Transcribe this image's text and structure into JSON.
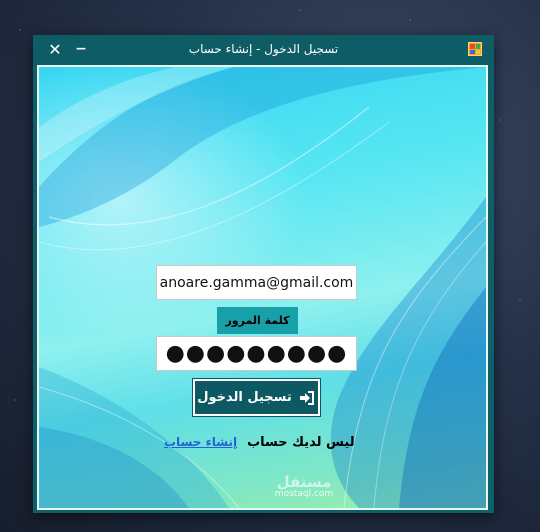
{
  "window": {
    "title": "تسجيل الدخول - إنشاء حساب",
    "close_glyph": "✕",
    "minimize_glyph": "−"
  },
  "form": {
    "email_value": "anoare.gamma@gmail.com",
    "password_label": "كلمة المرور",
    "password_value": "●●●●●●●●●",
    "login_button_label": "تسجيل الدخول",
    "no_account_text": "ليس لديك حساب",
    "create_account_link": "إنشاء حساب"
  },
  "watermark": {
    "text": "mostaql.com"
  },
  "icons": {
    "close": "close-icon",
    "minimize": "minimize-icon",
    "app": "app-icon",
    "login": "sign-in-icon"
  },
  "colors": {
    "titlebar": "#0e5c66",
    "button": "#0d5963",
    "label_bg": "#18a0a8",
    "link": "#2463d6"
  }
}
